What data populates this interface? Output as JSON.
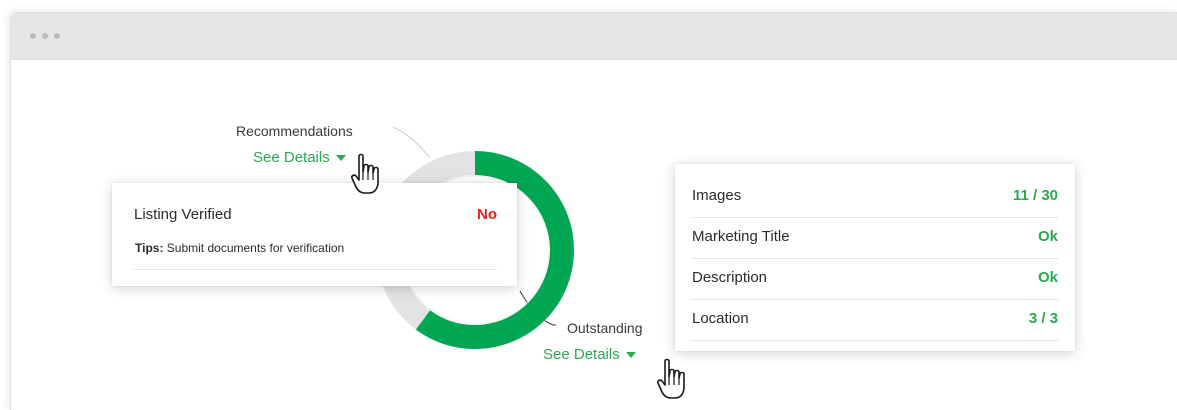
{
  "chart": {
    "progress_color": "#00a651",
    "track_color": "#e3e3e3"
  },
  "recommendations": {
    "label": "Recommendations",
    "link_label": "See Details",
    "popup": {
      "item_label": "Listing Verified",
      "item_value": "No",
      "tips_prefix": "Tips:",
      "tips_text": "Submit documents for verification"
    }
  },
  "outstanding": {
    "label": "Outstanding",
    "link_label": "See Details",
    "popup": {
      "rows": [
        {
          "label": "Images",
          "value": "11 / 30"
        },
        {
          "label": "Marketing Title",
          "value": "Ok"
        },
        {
          "label": "Description",
          "value": "Ok"
        },
        {
          "label": "Location",
          "value": "3 / 3"
        }
      ]
    }
  },
  "colors": {
    "accent": "#2aa94f",
    "negative": "#e2231a"
  },
  "icons": {
    "window_dots": "window-dots-icon",
    "caret": "caret-down-icon",
    "cursor": "hand-cursor-icon"
  }
}
